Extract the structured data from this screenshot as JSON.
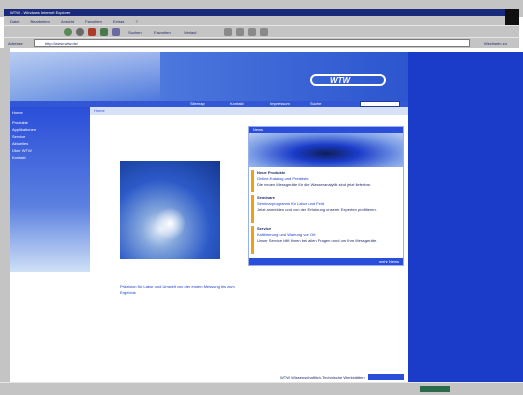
{
  "browser": {
    "title": "WTW - Windows Internet Explorer",
    "menu": [
      "Datei",
      "Bearbeiten",
      "Ansicht",
      "Favoriten",
      "Extras",
      "?"
    ],
    "toolbar_labels": [
      "Zurück",
      "Suchen",
      "Favoriten",
      "Verlauf"
    ],
    "address_label": "Adresse",
    "address_value": "http://www.wtw.de/",
    "go_label": "Wechseln zu"
  },
  "site": {
    "logo": "WTW",
    "top_links": [
      "Sitemap",
      "Kontakt",
      "Impressum",
      "Suche"
    ],
    "nav": [
      "Home",
      "Produkte",
      "Applikationen",
      "Service",
      "Aktuelles",
      "Über WTW",
      "Kontakt"
    ],
    "breadcrumb": "Home",
    "news_header": "News",
    "news_items": [
      {
        "title": "Neue Produkte",
        "link": "Online-Katalog und Preisliste",
        "text": "Die neuen Messgeräte für die Wasseranalytik sind jetzt lieferbar."
      },
      {
        "title": "Seminare",
        "link": "Seminarprogramm für Labor und Feld",
        "text": "Jetzt anmelden und von der Erfahrung unserer Experten profitieren."
      },
      {
        "title": "Service",
        "link": "Kalibrierung und Wartung vor Ort",
        "text": "Unser Service hilft Ihnen bei allen Fragen rund um Ihre Messgeräte."
      }
    ],
    "more_link": "mehr News",
    "tagline": "Präzision für Labor und Umwelt von der ersten Messung bis zum Ergebnis",
    "footer_text": "WTW Wissenschaftlich-Technische Werkstätten",
    "colors": {
      "accent": "#1b3cc9",
      "nav_bg": "#2a4ed9",
      "header_bg": "#3a67d8",
      "news_bullet": "#f0a018"
    }
  }
}
